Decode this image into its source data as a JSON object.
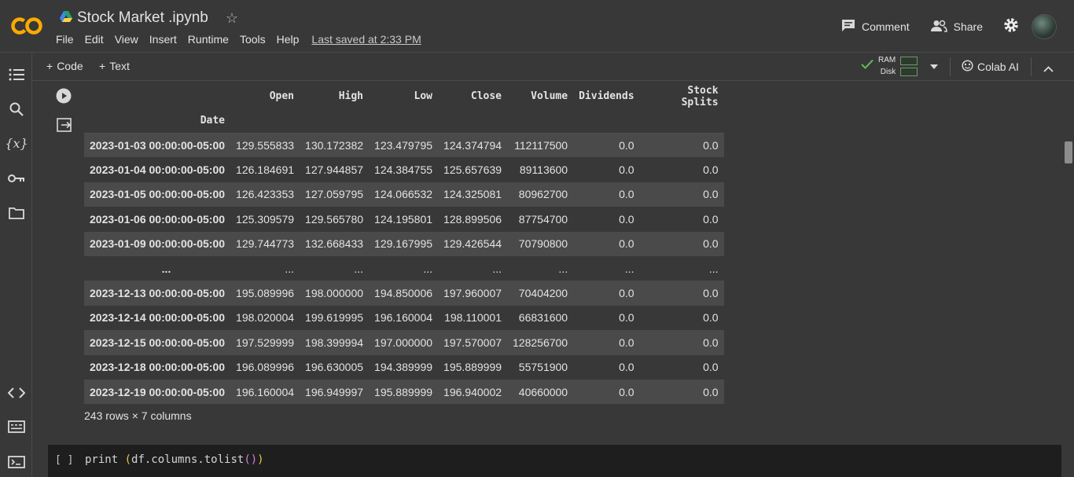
{
  "header": {
    "title": "Stock Market .ipynb",
    "menu": [
      "File",
      "Edit",
      "View",
      "Insert",
      "Runtime",
      "Tools",
      "Help"
    ],
    "last_saved": "Last saved at 2:33 PM",
    "comment_label": "Comment",
    "share_label": "Share"
  },
  "toolbar": {
    "code_label": "Code",
    "text_label": "Text",
    "ram_label": "RAM",
    "disk_label": "Disk",
    "colab_ai_label": "Colab AI"
  },
  "colors": {
    "background": "#383838",
    "cell_background": "#1e1e1e",
    "logo_orange": "#f9ab00",
    "status_green": "#5fb95f"
  },
  "icons": {
    "rail": [
      "table-of-contents-icon",
      "search-icon",
      "variables-icon",
      "secrets-key-icon",
      "files-folder-icon",
      "code-snippets-icon",
      "command-palette-icon",
      "terminal-icon"
    ]
  },
  "dataframe": {
    "columns": [
      "Open",
      "High",
      "Low",
      "Close",
      "Volume",
      "Dividends",
      "Stock Splits"
    ],
    "index_name": "Date",
    "ellipsis": "...",
    "rows_top": [
      {
        "date": "2023-01-03 00:00:00-05:00",
        "open": "129.555833",
        "high": "130.172382",
        "low": "123.479795",
        "close": "124.374794",
        "volume": "112117500",
        "dividends": "0.0",
        "splits": "0.0"
      },
      {
        "date": "2023-01-04 00:00:00-05:00",
        "open": "126.184691",
        "high": "127.944857",
        "low": "124.384755",
        "close": "125.657639",
        "volume": "89113600",
        "dividends": "0.0",
        "splits": "0.0"
      },
      {
        "date": "2023-01-05 00:00:00-05:00",
        "open": "126.423353",
        "high": "127.059795",
        "low": "124.066532",
        "close": "124.325081",
        "volume": "80962700",
        "dividends": "0.0",
        "splits": "0.0"
      },
      {
        "date": "2023-01-06 00:00:00-05:00",
        "open": "125.309579",
        "high": "129.565780",
        "low": "124.195801",
        "close": "128.899506",
        "volume": "87754700",
        "dividends": "0.0",
        "splits": "0.0"
      },
      {
        "date": "2023-01-09 00:00:00-05:00",
        "open": "129.744773",
        "high": "132.668433",
        "low": "129.167995",
        "close": "129.426544",
        "volume": "70790800",
        "dividends": "0.0",
        "splits": "0.0"
      }
    ],
    "rows_bottom": [
      {
        "date": "2023-12-13 00:00:00-05:00",
        "open": "195.089996",
        "high": "198.000000",
        "low": "194.850006",
        "close": "197.960007",
        "volume": "70404200",
        "dividends": "0.0",
        "splits": "0.0"
      },
      {
        "date": "2023-12-14 00:00:00-05:00",
        "open": "198.020004",
        "high": "199.619995",
        "low": "196.160004",
        "close": "198.110001",
        "volume": "66831600",
        "dividends": "0.0",
        "splits": "0.0"
      },
      {
        "date": "2023-12-15 00:00:00-05:00",
        "open": "197.529999",
        "high": "198.399994",
        "low": "197.000000",
        "close": "197.570007",
        "volume": "128256700",
        "dividends": "0.0",
        "splits": "0.0"
      },
      {
        "date": "2023-12-18 00:00:00-05:00",
        "open": "196.089996",
        "high": "196.630005",
        "low": "194.389999",
        "close": "195.889999",
        "volume": "55751900",
        "dividends": "0.0",
        "splits": "0.0"
      },
      {
        "date": "2023-12-19 00:00:00-05:00",
        "open": "196.160004",
        "high": "196.949997",
        "low": "195.889999",
        "close": "196.940002",
        "volume": "40660000",
        "dividends": "0.0",
        "splits": "0.0"
      }
    ],
    "shape_note": "243 rows × 7 columns"
  },
  "code_cell": {
    "prompt": "[ ]",
    "code_prefix": "print ",
    "code_inner": "df.columns.tolist"
  }
}
